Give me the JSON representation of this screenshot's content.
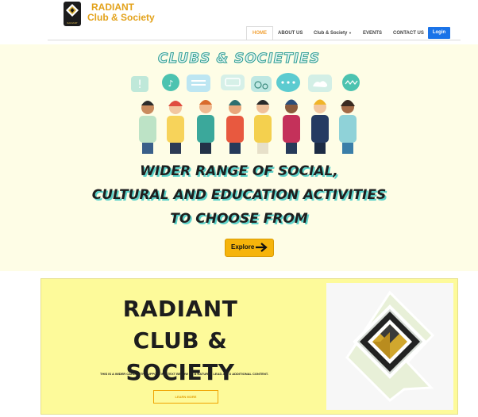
{
  "brand": {
    "line1": "RADIANT",
    "line2": "Club & Society",
    "logo_caption": "RADIANT"
  },
  "nav": {
    "items": [
      {
        "label": "HOME",
        "active": true
      },
      {
        "label": "ABOUT US"
      },
      {
        "label": "Club & Society",
        "has_dropdown": true
      },
      {
        "label": "EVENTS"
      },
      {
        "label": "CONTACT US"
      }
    ],
    "login_label": "Login"
  },
  "hero": {
    "title": "CLUBS & SOCIETIES",
    "headline_lines": [
      "WIDER RANGE OF SOCIAL,",
      "CULTURAL AND EDUCATION ACTIVITIES",
      "TO CHOOSE FROM"
    ],
    "button_label": "Explore"
  },
  "card": {
    "title_line1": "RADIANT CLUB &",
    "title_line2": "SOCIETY",
    "text": "THIS IS A WIDER CARD WITH SUPPORTING TEXT BELOW AS A NATURAL LEAD-IN TO ADDITIONAL CONTENT.",
    "button_label": "LEARN MORE"
  },
  "colors": {
    "brand": "#e3a21a",
    "login": "#1a73e8",
    "explore": "#f6b40b",
    "hero_bg": "#fefde6",
    "card_bg": "#fdfa9a",
    "accent_teal": "#5ad1c9"
  }
}
